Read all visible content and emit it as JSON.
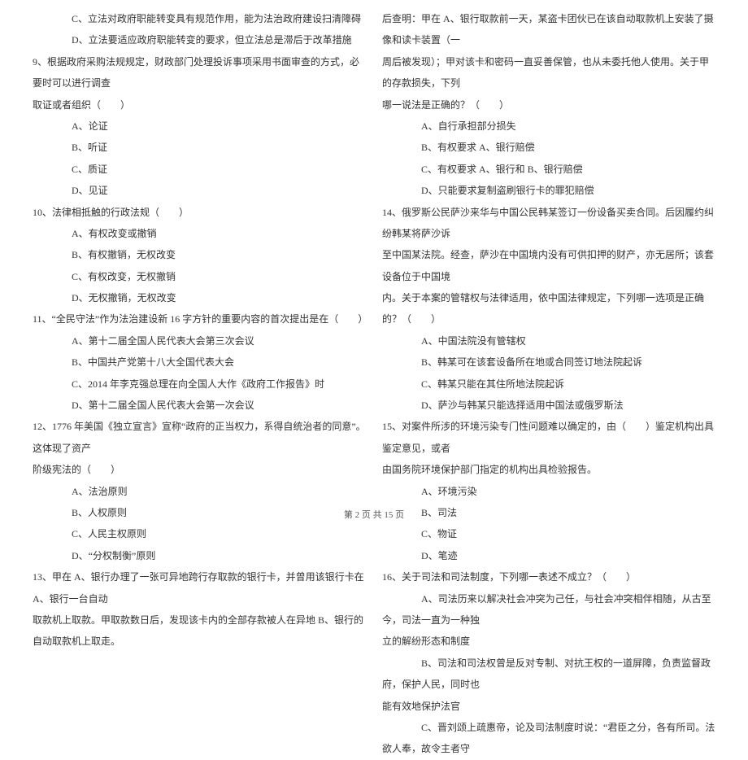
{
  "left": {
    "l1": "C、立法对政府职能转变具有规范作用，能为法治政府建设扫清障碍",
    "l2": "D、立法要适应政府职能转变的要求，但立法总是滞后于改革措施",
    "l3": "9、根据政府采购法规规定，财政部门处理投诉事项采用书面审查的方式，必要时可以进行调查",
    "l4": "取证或者组织（　　）",
    "l5": "A、论证",
    "l6": "B、听证",
    "l7": "C、质证",
    "l8": "D、见证",
    "l9": "10、法律相抵触的行政法规（　　）",
    "l10": "A、有权改变或撤销",
    "l11": "B、有权撤销，无权改变",
    "l12": "C、有权改变，无权撤销",
    "l13": "D、无权撤销，无权改变",
    "l14": "11、“全民守法”作为法治建设新 16 字方针的重要内容的首次提出是在（　　）",
    "l15": "A、第十二届全国人民代表大会第三次会议",
    "l16": "B、中国共产党第十八大全国代表大会",
    "l17": "C、2014 年李克强总理在向全国人大作《政府工作报告》时",
    "l18": "D、第十二届全国人民代表大会第一次会议",
    "l19": "12、1776 年美国《独立宣言》宣称“政府的正当权力，系得自统治者的同意”。这体现了资产",
    "l20": "阶级宪法的（　　）",
    "l21": "A、法治原则",
    "l22": "B、人权原则",
    "l23": "C、人民主权原则",
    "l24": "D、“分权制衡”原则",
    "l25": "13、甲在 A、银行办理了一张可异地跨行存取款的银行卡，并曾用该银行卡在 A、银行一台自动",
    "l26": "取款机上取款。甲取款数日后，发现该卡内的全部存款被人在异地 B、银行的自动取款机上取走。"
  },
  "right": {
    "r1": "后查明：甲在 A、银行取款前一天，某盗卡团伙已在该自动取款机上安装了摄像和读卡装置（一",
    "r2": "周后被发现）；甲对该卡和密码一直妥善保管，也从未委托他人使用。关于甲的存款损失，下列",
    "r3": "哪一说法是正确的？（　　）",
    "r4": "A、自行承担部分损失",
    "r5": "B、有权要求 A、银行赔偿",
    "r6": "C、有权要求 A、银行和 B、银行赔偿",
    "r7": "D、只能要求复制盗刷银行卡的罪犯赔偿",
    "r8": "14、俄罗斯公民萨沙来华与中国公民韩某签订一份设备买卖合同。后因履约纠纷韩某将萨沙诉",
    "r9": "至中国某法院。经查，萨沙在中国境内没有可供扣押的财产，亦无居所；该套设备位于中国境",
    "r10": "内。关于本案的管辖权与法律适用，依中国法律规定，下列哪一选项是正确的？（　　）",
    "r11": "A、中国法院没有管辖权",
    "r12": "B、韩某可在该套设备所在地或合同签订地法院起诉",
    "r13": "C、韩某只能在其住所地法院起诉",
    "r14": "D、萨沙与韩某只能选择适用中国法或俄罗斯法",
    "r15": "15、对案件所涉的环境污染专门性问题难以确定的，由（　　）鉴定机构出具鉴定意见，或者",
    "r16": "由国务院环境保护部门指定的机构出具检验报告。",
    "r17": "A、环境污染",
    "r18": "B、司法",
    "r19": "C、物证",
    "r20": "D、笔迹",
    "r21": "16、关于司法和司法制度，下列哪一表述不成立？（　　）",
    "r22": "A、司法历来以解决社会冲突为己任，与社会冲突相伴相随，从古至今，司法一直为一种独",
    "r23": "立的解纷形态和制度",
    "r24": "B、司法和司法权曾是反对专制、对抗王权的一道屏障，负责监督政府，保护人民，同时也",
    "r25": "能有效地保护法官",
    "r26": "C、晋刘颂上疏惠帝，论及司法制度时说：“君臣之分，各有所司。法欲人奉，故令主者守"
  },
  "footer": "第 2 页 共 15 页"
}
